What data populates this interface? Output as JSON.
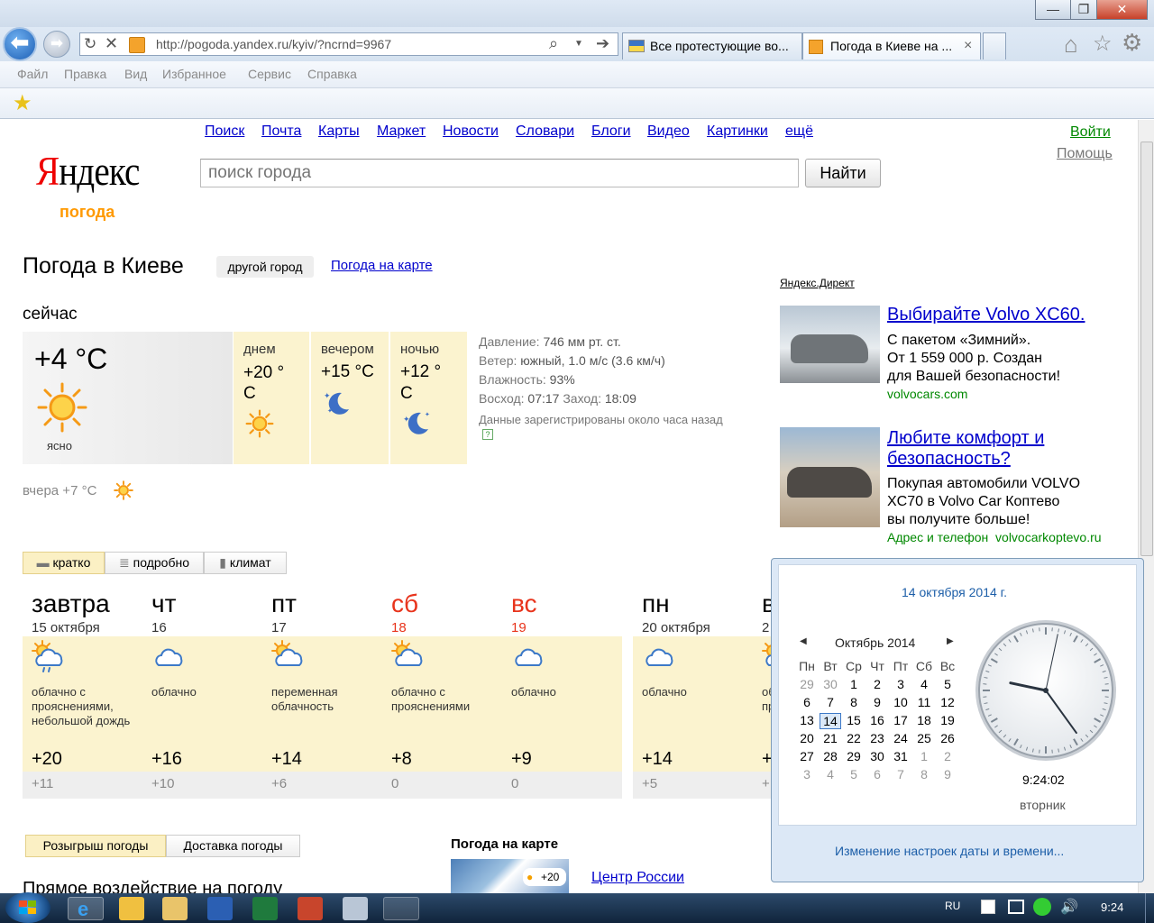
{
  "browser": {
    "address": "http://pogoda.yandex.ru/kyiv/?ncrnd=9967",
    "tabs": [
      {
        "label": "Все протестующие во..."
      },
      {
        "label": "Погода в Киеве на ..."
      }
    ],
    "tab_close": "×",
    "window_controls": {
      "minimize": "—",
      "maximize": "❐",
      "close": "✕"
    },
    "menu": [
      "Файл",
      "Правка",
      "Вид",
      "Избранное",
      "Сервис",
      "Справка"
    ]
  },
  "header": {
    "logo": "Яндекс",
    "logo_first_letter": "Я",
    "logo_rest": "ндекс",
    "service": "погода",
    "nav": [
      "Поиск",
      "Почта",
      "Карты",
      "Маркет",
      "Новости",
      "Словари",
      "Блоги",
      "Видео",
      "Картинки",
      "ещё"
    ],
    "login": "Войти",
    "help": "Помощь",
    "search_placeholder": "поиск города",
    "search_button": "Найти"
  },
  "title": {
    "heading": "Погода в Киеве",
    "other_city": "другой город",
    "map_link": "Погода на карте"
  },
  "now": {
    "label": "сейчас",
    "temp": "+4 °C",
    "cond": "ясно",
    "parts": [
      {
        "name": "днем",
        "temp": "+20 °",
        "unit": "С"
      },
      {
        "name": "вечером",
        "temp": "+15 °C",
        "unit": ""
      },
      {
        "name": "ночью",
        "temp": "+12 °",
        "unit": "С"
      }
    ],
    "pressure_label": "Давление:",
    "pressure": "746 мм рт. ст.",
    "wind_label": "Ветер:",
    "wind": "южный, 1.0 м/с (3.6 км/ч)",
    "humidity_label": "Влажность:",
    "humidity": "93%",
    "sunrise_label": "Восход:",
    "sunrise": "07:17",
    "sunset_label": "Заход:",
    "sunset": "18:09",
    "registered": "Данные зарегистрированы около часа назад",
    "help_icon": "?",
    "yesterday": "вчера +7 °C"
  },
  "view_tabs": [
    "кратко",
    "подробно",
    "климат"
  ],
  "forecast": [
    {
      "day": "завтра",
      "date": "15 октября",
      "desc": "облачно с прояснениями, небольшой дождь",
      "high": "+20",
      "low": "+11",
      "weekend": false
    },
    {
      "day": "чт",
      "date": "16",
      "desc": "облачно",
      "high": "+16",
      "low": "+10",
      "weekend": false
    },
    {
      "day": "пт",
      "date": "17",
      "desc": "переменная облачность",
      "high": "+14",
      "low": "+6",
      "weekend": false
    },
    {
      "day": "сб",
      "date": "18",
      "desc": "облачно с прояснениями",
      "high": "+8",
      "low": "0",
      "weekend": true
    },
    {
      "day": "вс",
      "date": "19",
      "desc": "облачно",
      "high": "+9",
      "low": "0",
      "weekend": true
    },
    {
      "day": "пн",
      "date": "20 октября",
      "desc": "облачно",
      "high": "+14",
      "low": "+5",
      "weekend": false
    },
    {
      "day": "в",
      "date": "2",
      "desc": "об пр",
      "high": "+",
      "low": "+",
      "weekend": false
    }
  ],
  "bottom": {
    "tabs": [
      "Розыгрыш погоды",
      "Доставка погоды"
    ],
    "heading": "Прямое воздействие на погоду",
    "map_title": "Погода на карте",
    "map_temp": "+20",
    "map_link": "Центр России"
  },
  "ads": {
    "label": "Яндекс.Директ",
    "items": [
      {
        "title": "Выбирайте Volvo XC60.",
        "lines": [
          "С пакетом «Зимний».",
          "От 1 559 000 р. Создан",
          "для Вашей безопасности!"
        ],
        "domain": "volvocars.com"
      },
      {
        "title": "Любите комфорт и безопасность?",
        "lines": [
          "Покупая автомобили VOLVO",
          "XC70 в Volvo Car Коптево",
          "вы получите больше!"
        ],
        "domain_label": "Адрес и телефон",
        "domain": "volvocarkoptevo.ru"
      }
    ]
  },
  "calendar": {
    "date_header": "14 октября 2014 г.",
    "month": "Октябрь 2014",
    "prev": "◀",
    "next": "▶",
    "weekdays": [
      "Пн",
      "Вт",
      "Ср",
      "Чт",
      "Пт",
      "Сб",
      "Вс"
    ],
    "weeks": [
      [
        "29",
        "30",
        "1",
        "2",
        "3",
        "4",
        "5"
      ],
      [
        "6",
        "7",
        "8",
        "9",
        "10",
        "11",
        "12"
      ],
      [
        "13",
        "14",
        "15",
        "16",
        "17",
        "18",
        "19"
      ],
      [
        "20",
        "21",
        "22",
        "23",
        "24",
        "25",
        "26"
      ],
      [
        "27",
        "28",
        "29",
        "30",
        "31",
        "1",
        "2"
      ],
      [
        "3",
        "4",
        "5",
        "6",
        "7",
        "8",
        "9"
      ]
    ],
    "selected": "14",
    "time": "9:24:02",
    "weekday": "вторник",
    "settings_link": "Изменение настроек даты и времени...",
    "clock": {
      "hour": 9,
      "minute": 24,
      "second": 2
    }
  },
  "taskbar": {
    "lang": "RU",
    "time": "9:24"
  }
}
